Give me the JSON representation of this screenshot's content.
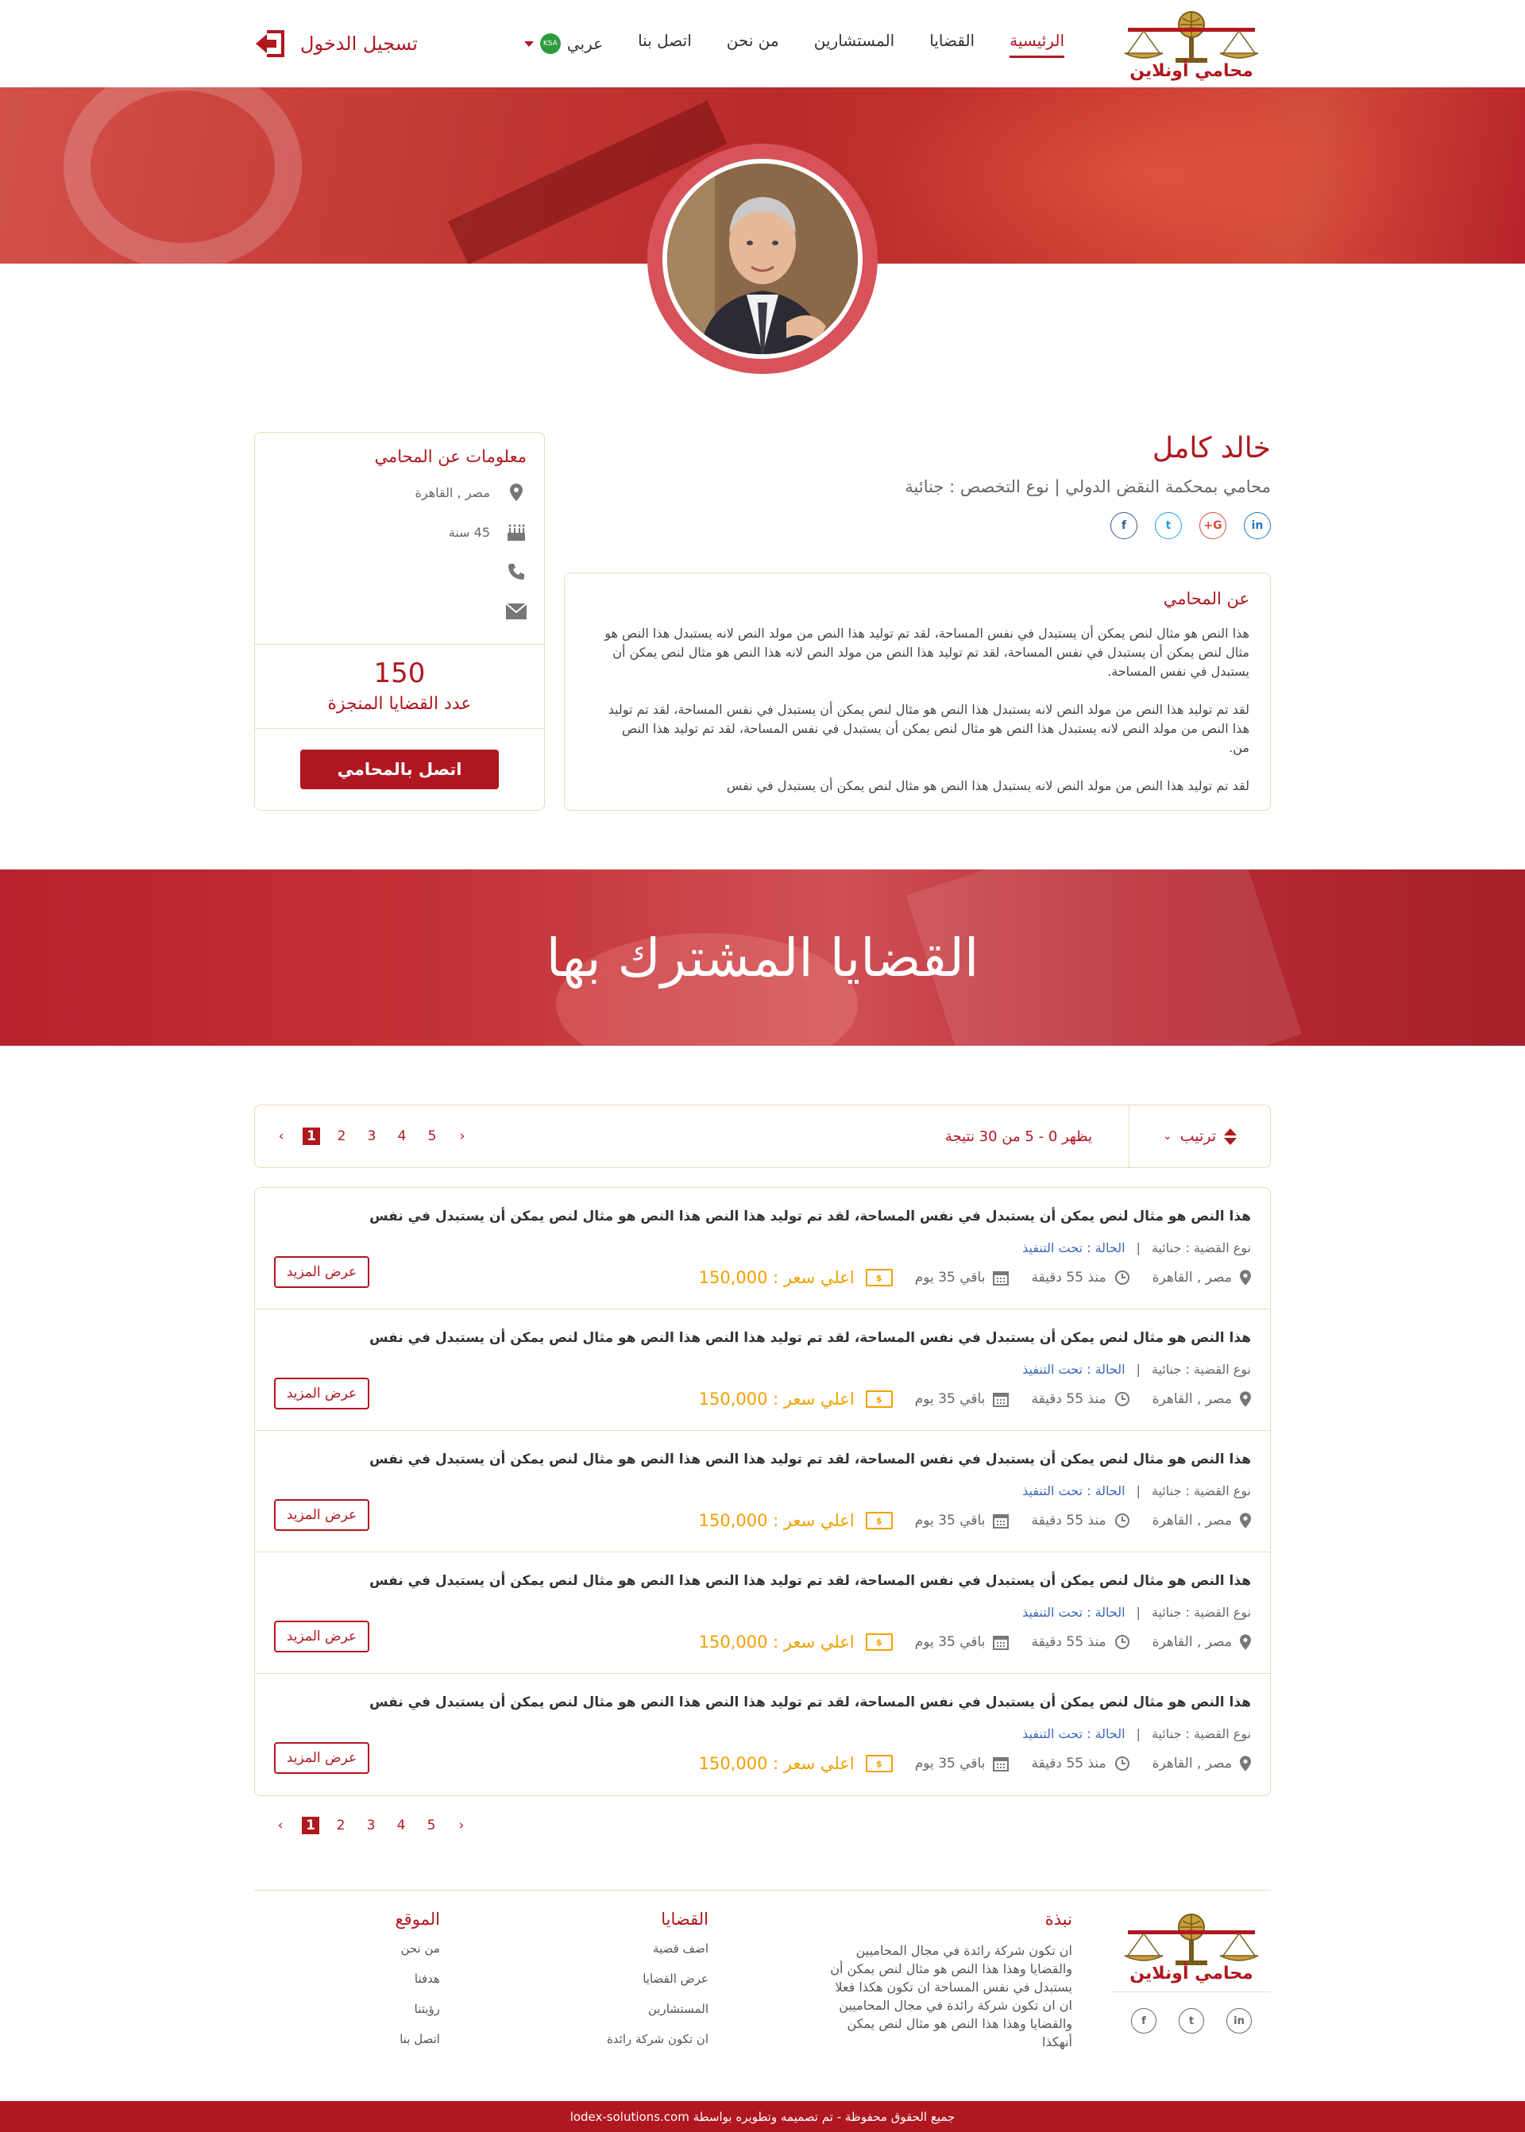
{
  "header": {
    "logo_text": "محامي أونلاين",
    "nav": [
      "الرئيسية",
      "القضايا",
      "المستشارين",
      "من نحن",
      "اتصل بنا"
    ],
    "language": "عربي",
    "flag_label": "KSA",
    "login": "تسجيل الدخول"
  },
  "lawyer": {
    "name": "خالد كامل",
    "title": "محامي بمحكمة النقض الدولي",
    "specialty": "نوع التخصص : جنائية",
    "social": [
      "in",
      "G+",
      "t",
      "f"
    ],
    "about_title": "عن المحامي",
    "about_paragraphs": [
      "هذا النص هو مثال لنص يمكن أن يستبدل في نفس المساحة، لقد تم توليد هذا النص من مولد النص لانه يستبدل هذا النص هو مثال لنص يمكن أن يستبدل في نفس المساحة، لقد تم توليد هذا النص من مولد النص لانه هذا النص هو مثال لنص يمكن أن يستبدل في نفس المساحة.",
      "لقد تم توليد هذا النص من مولد النص لانه يستبدل هذا النص هو مثال لنص يمكن أن يستبدل في نفس المساحة، لقد تم توليد هذا النص من مولد النص لانه يستبدل هذا النص هو مثال لنص يمكن أن يستبدل في نفس المساحة، لقد تم توليد هذا النص من.",
      "لقد تم توليد هذا النص من مولد النص لانه يستبدل هذا النص هو مثال لنص يمكن أن يستبدل في نفس"
    ],
    "info_title": "معلومات عن المحامي",
    "location": "مصر , القاهرة",
    "age": "45 سنة",
    "phone": "",
    "email": "",
    "cases_count": "150",
    "cases_label": "عدد القضايا المنجزة",
    "contact_button": "اتصل بالمحامي"
  },
  "banner": {
    "title": "القضايا المشترك بها"
  },
  "toolbar": {
    "sort_label": "ترتيب",
    "results_text": "يظهر 0 - 5 من 30 نتيجة",
    "pages": [
      "1",
      "2",
      "3",
      "4",
      "5"
    ],
    "prev": "‹",
    "next": "›"
  },
  "cases": [
    {
      "title": "هذا النص هو مثال لنص يمكن أن يستبدل في نفس المساحة، لقد تم توليد هذا النص هذا النص هو مثال لنص يمكن أن يستبدل في نفس",
      "type": "نوع القضية : جنائية",
      "status": "الحالة : تحت التنفيذ",
      "location": "مصر , القاهرة",
      "time": "منذ 55 دقيقة",
      "remaining": "باقي 35 يوم",
      "price": "اعلي سعر : 150,000",
      "more": "عرض المزيد"
    },
    {
      "title": "هذا النص هو مثال لنص يمكن أن يستبدل في نفس المساحة، لقد تم توليد هذا النص هذا النص هو مثال لنص يمكن أن يستبدل في نفس",
      "type": "نوع القضية : جنائية",
      "status": "الحالة : تحت التنفيذ",
      "location": "مصر , القاهرة",
      "time": "منذ 55 دقيقة",
      "remaining": "باقي 35 يوم",
      "price": "اعلي سعر : 150,000",
      "more": "عرض المزيد"
    },
    {
      "title": "هذا النص هو مثال لنص يمكن أن يستبدل في نفس المساحة، لقد تم توليد هذا النص هذا النص هو مثال لنص يمكن أن يستبدل في نفس",
      "type": "نوع القضية : جنائية",
      "status": "الحالة : تحت التنفيذ",
      "location": "مصر , القاهرة",
      "time": "منذ 55 دقيقة",
      "remaining": "باقي 35 يوم",
      "price": "اعلي سعر : 150,000",
      "more": "عرض المزيد"
    },
    {
      "title": "هذا النص هو مثال لنص يمكن أن يستبدل في نفس المساحة، لقد تم توليد هذا النص هذا النص هو مثال لنص يمكن أن يستبدل في نفس",
      "type": "نوع القضية : جنائية",
      "status": "الحالة : تحت التنفيذ",
      "location": "مصر , القاهرة",
      "time": "منذ 55 دقيقة",
      "remaining": "باقي 35 يوم",
      "price": "اعلي سعر : 150,000",
      "more": "عرض المزيد"
    },
    {
      "title": "هذا النص هو مثال لنص يمكن أن يستبدل في نفس المساحة، لقد تم توليد هذا النص هذا النص هو مثال لنص يمكن أن يستبدل في نفس",
      "type": "نوع القضية : جنائية",
      "status": "الحالة : تحت التنفيذ",
      "location": "مصر , القاهرة",
      "time": "منذ 55 دقيقة",
      "remaining": "باقي 35 يوم",
      "price": "اعلي سعر : 150,000",
      "more": "عرض المزيد"
    }
  ],
  "footer": {
    "about_title": "نبذة",
    "about_text": "ان تكون شركة رائدة في مجال المحاميين والقضايا وهذا هذا النص هو مثال لنص يمكن أن يستبدل في نفس المساحة ان تكون هكذا فعلا ان ان تكون شركة رائدة في مجال المحاميين والقضايا وهذا هذا النص هو مثال لنص يمكن أنهكذا",
    "cases_title": "القضايا",
    "cases_links": [
      "اضف قضية",
      "عرض القضايا",
      "المستشارين",
      "ان تكون شركة رائدة"
    ],
    "site_title": "الموقع",
    "site_links": [
      "من نحن",
      "هدفنا",
      "رؤيتنا",
      "اتصل بنا"
    ],
    "social": [
      "in",
      "t",
      "f"
    ],
    "copyright": "جميع الحقوق محفوظة - تم تصميمه وتطويره بواسطة lodex-solutions.com"
  },
  "colors": {
    "brand": "#b0171f",
    "gold": "#f0a000",
    "status": "#3a67b8",
    "border": "#eadcb4"
  }
}
